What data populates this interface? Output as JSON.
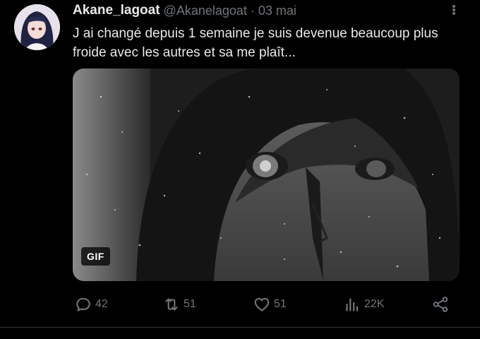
{
  "tweet": {
    "author_name": "Akane_lagoat",
    "author_handle": "@Akanelagoat",
    "separator": "·",
    "date": "03 mai",
    "text": "J ai changé depuis 1 semaine je suis devenue beaucoup plus froide avec les autres et sa me plaît...",
    "media": {
      "badge": "GIF",
      "kind": "animated-gif"
    },
    "actions": {
      "replies": "42",
      "reposts": "51",
      "likes": "51",
      "views": "22K"
    }
  },
  "icons": {
    "more": "more-icon",
    "reply": "reply-icon",
    "repost": "repost-icon",
    "like": "heart-icon",
    "views": "views-chart-icon",
    "share": "share-icon"
  },
  "colors": {
    "background": "#000000",
    "text": "#e7e9ea",
    "secondary": "#71767b"
  }
}
